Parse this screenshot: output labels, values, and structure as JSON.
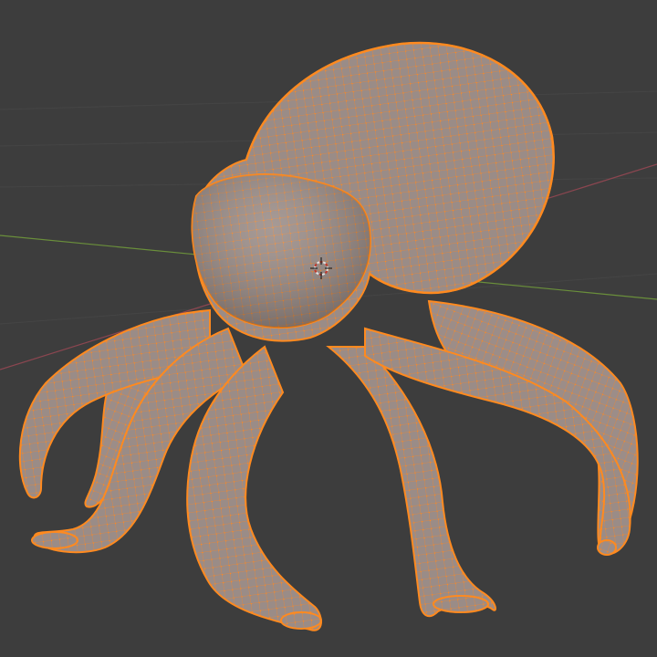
{
  "viewport": {
    "background_color": "#3d3d3d",
    "grid_color": "#474747",
    "axis_x_color": "#9b4a52",
    "axis_y_color": "#6a8f3b"
  },
  "object": {
    "name_icon": "octopus-mesh",
    "mode": "edit-mode",
    "surface_color": "#9a8c87",
    "wireframe_color": "#e5863a",
    "vertex_color": "#ff8a1f",
    "selection": "all-vertices-selected"
  },
  "cursor_3d": {
    "icon": "3d-cursor-icon",
    "color_a": "#e0e0e0",
    "color_b": "#c0392b"
  }
}
